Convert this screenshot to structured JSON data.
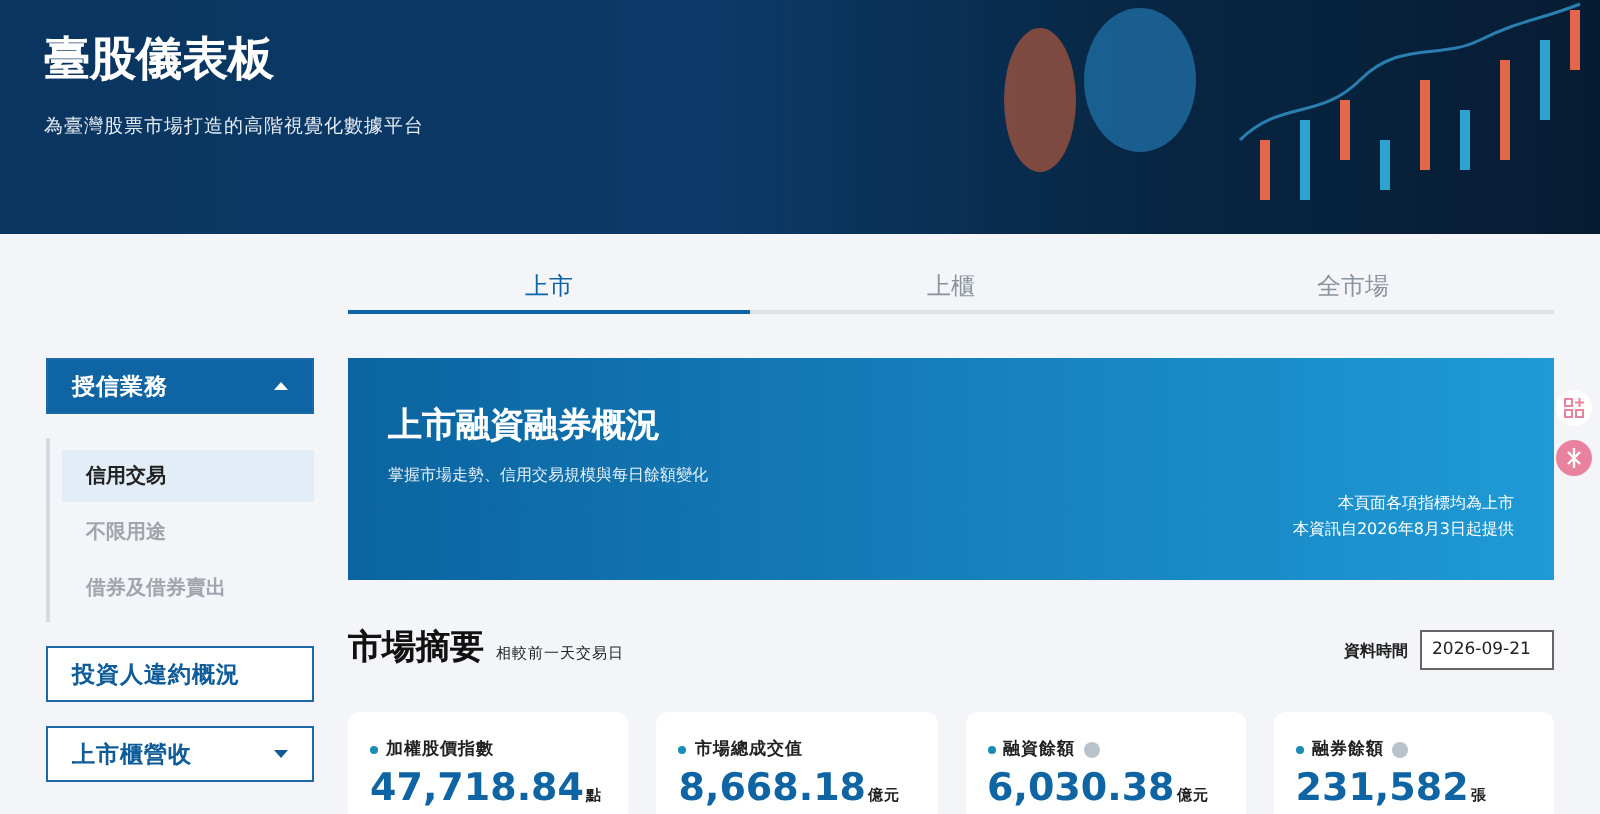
{
  "header": {
    "title": "臺股儀表板",
    "subtitle": "為臺灣股票市場打造的高階視覺化數據平台"
  },
  "tabs": [
    {
      "label": "上市",
      "selected": true
    },
    {
      "label": "上櫃",
      "selected": false
    },
    {
      "label": "全市場",
      "selected": false
    }
  ],
  "sidebar": {
    "groups": [
      {
        "label": "授信業務",
        "expanded": true,
        "has_caret": true,
        "children": [
          {
            "label": "信用交易",
            "selected": true
          },
          {
            "label": "不限用途",
            "selected": false
          },
          {
            "label": "借券及借券賣出",
            "selected": false
          }
        ]
      },
      {
        "label": "投資人違約概況",
        "expanded": false,
        "has_caret": false
      },
      {
        "label": "上市櫃營收",
        "expanded": false,
        "has_caret": true
      }
    ]
  },
  "banner": {
    "title": "上市融資融券概況",
    "subtitle": "掌握市場走勢、信用交易規模與每日餘額變化",
    "notes": [
      "本頁面各項指標均為上市",
      "本資訊自2026年8月3日起提供"
    ]
  },
  "summary": {
    "title": "市場摘要",
    "caption": "相較前一天交易日",
    "date_label": "資料時間",
    "date_value": "2026-09-21"
  },
  "cards": [
    {
      "label": "加權股價指數",
      "info": false,
      "value": "47,718.84",
      "unit": "點"
    },
    {
      "label": "市場總成交值",
      "info": false,
      "value": "8,668.18",
      "unit": "億元"
    },
    {
      "label": "融資餘額",
      "info": true,
      "value": "6,030.38",
      "unit": "億元"
    },
    {
      "label": "融券餘額",
      "info": true,
      "value": "231,582",
      "unit": "張"
    }
  ]
}
